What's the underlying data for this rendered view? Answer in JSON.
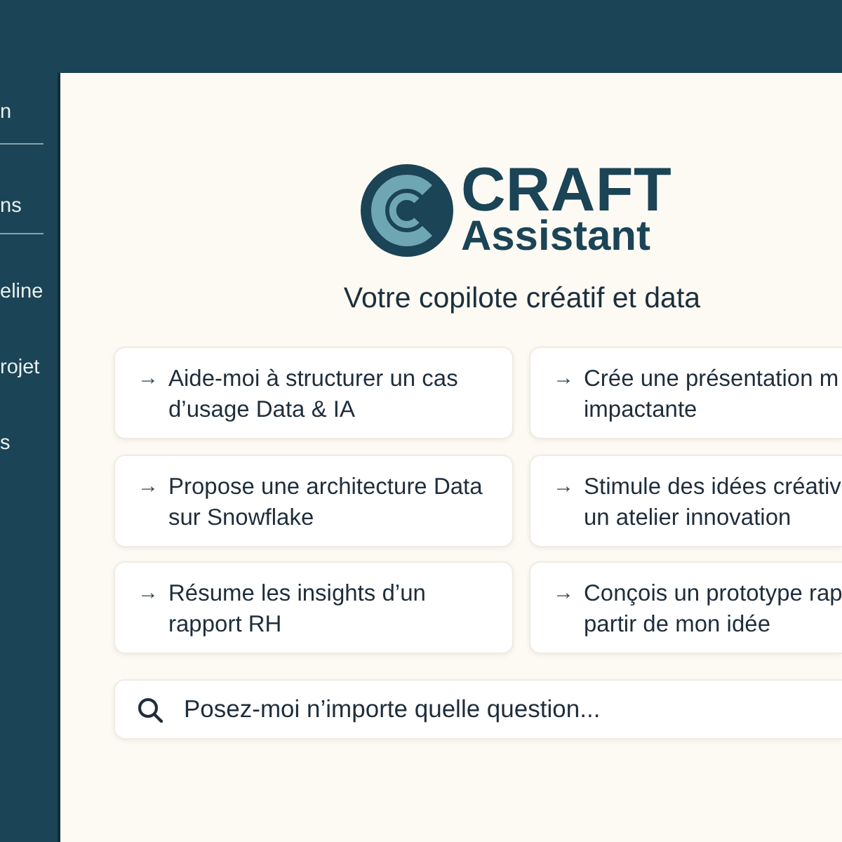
{
  "sidebar": {
    "sections": [
      {
        "items": [
          {
            "label": "n"
          }
        ]
      },
      {
        "items": [
          {
            "label": "ns"
          }
        ]
      },
      {
        "items": [
          {
            "label": "eline"
          },
          {
            "label": "rojet"
          },
          {
            "label": "s"
          }
        ]
      }
    ]
  },
  "hero": {
    "brand": "CRAFT",
    "product": "Assistant",
    "tagline": "Votre copilote créatif et data"
  },
  "suggestions": [
    {
      "icon": "→",
      "lines": [
        "Aide-moi à structurer un cas",
        "d’usage Data & IA"
      ]
    },
    {
      "icon": "→",
      "lines": [
        "Crée une présentation m",
        "impactante"
      ]
    },
    {
      "icon": "→",
      "lines": [
        "Propose une architecture Data",
        "sur Snowflake"
      ]
    },
    {
      "icon": "→",
      "lines": [
        "Stimule des idées créativ",
        "un atelier innovation"
      ]
    },
    {
      "icon": "→",
      "lines": [
        "Résume les insights d’un",
        "rapport RH"
      ]
    },
    {
      "icon": "→",
      "lines": [
        "Conçois un prototype rap",
        "partir de mon idée"
      ]
    }
  ],
  "search": {
    "placeholder": "Posez-moi n’importe quelle question..."
  }
}
